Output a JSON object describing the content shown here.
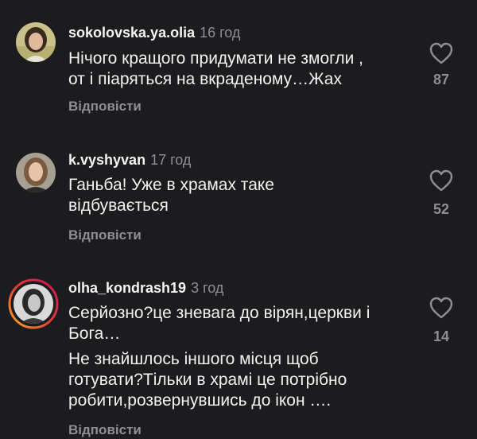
{
  "comments": [
    {
      "username": "sokolovska.ya.olia",
      "time": "16 год",
      "text_lines": [
        "Нічого кращого придумати не змогли ,",
        "от і піаряться на вкраденому…Жах"
      ],
      "reply_label": "Відповісти",
      "likes": "87",
      "icon": "heart-outline-icon"
    },
    {
      "username": "k.vyshyvan",
      "time": "17 год",
      "text_lines": [
        "Ганьба! Уже в храмах таке",
        "відбувається"
      ],
      "reply_label": "Відповісти",
      "likes": "52",
      "icon": "heart-outline-icon"
    },
    {
      "username": "olha_kondrash19",
      "time": "3 год",
      "text_lines": [
        "Серйозно?це зневага до вірян,церкви і",
        "Бога…",
        "Не знайшлось іншого місця щоб",
        "готувати?Тільки в храмі це потрібно",
        "робити,розвернувшись до ікон …."
      ],
      "reply_label": "Відповісти",
      "likes": "14",
      "icon": "heart-outline-icon"
    }
  ],
  "colors": {
    "background": "#1c1c1e",
    "secondary_text": "#8e8e93",
    "story_ring_start": "#f9a825",
    "story_ring_end": "#c2185b"
  }
}
